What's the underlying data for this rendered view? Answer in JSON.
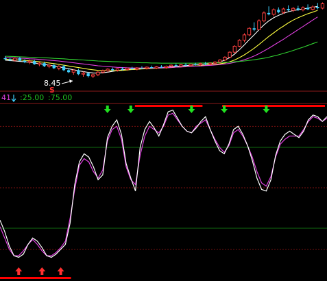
{
  "colors": {
    "background": "#000000",
    "divider": "#8b1a1a",
    "grid_red": "#7a1010",
    "grid_green": "#0f6b0f",
    "up_candle": "#ff4040",
    "down_candle": "#40d0ff",
    "ma_white": "#ffffff",
    "ma_yellow": "#ffff40",
    "ma_magenta": "#e040e0",
    "ma_green": "#30d030",
    "osc_white": "#ffffff",
    "osc_magenta": "#e040e0",
    "buy_arrow": "#ff3030",
    "sell_arrow": "#20e020",
    "bar_red": "#ff0000"
  },
  "price_panel": {
    "low_marker": "8.45",
    "signal_letter": "S"
  },
  "indicator_panel": {
    "value_text": "41",
    "level_low_text": ":25.00",
    "level_high_text": ":75.00"
  },
  "chart_data": [
    {
      "type": "candlestick",
      "annotation_low": "8.45",
      "ylim": [
        7.9,
        12.3
      ],
      "candles": [
        {
          "o": 9.45,
          "h": 9.55,
          "l": 9.35,
          "c": 9.4
        },
        {
          "o": 9.4,
          "h": 9.48,
          "l": 9.3,
          "c": 9.35
        },
        {
          "o": 9.35,
          "h": 9.5,
          "l": 9.28,
          "c": 9.45
        },
        {
          "o": 9.45,
          "h": 9.52,
          "l": 9.3,
          "c": 9.32
        },
        {
          "o": 9.32,
          "h": 9.4,
          "l": 9.2,
          "c": 9.25
        },
        {
          "o": 9.25,
          "h": 9.38,
          "l": 9.15,
          "c": 9.3
        },
        {
          "o": 9.3,
          "h": 9.36,
          "l": 9.12,
          "c": 9.15
        },
        {
          "o": 9.15,
          "h": 9.25,
          "l": 9.05,
          "c": 9.2
        },
        {
          "o": 9.2,
          "h": 9.28,
          "l": 9.0,
          "c": 9.05
        },
        {
          "o": 9.05,
          "h": 9.15,
          "l": 8.95,
          "c": 9.1
        },
        {
          "o": 9.1,
          "h": 9.18,
          "l": 8.9,
          "c": 8.95
        },
        {
          "o": 8.95,
          "h": 9.1,
          "l": 8.85,
          "c": 9.05
        },
        {
          "o": 9.05,
          "h": 9.12,
          "l": 8.8,
          "c": 8.85
        },
        {
          "o": 8.85,
          "h": 8.95,
          "l": 8.7,
          "c": 8.75
        },
        {
          "o": 8.75,
          "h": 8.9,
          "l": 8.62,
          "c": 8.85
        },
        {
          "o": 8.85,
          "h": 8.92,
          "l": 8.6,
          "c": 8.65
        },
        {
          "o": 8.65,
          "h": 8.78,
          "l": 8.52,
          "c": 8.7
        },
        {
          "o": 8.7,
          "h": 8.75,
          "l": 8.48,
          "c": 8.55
        },
        {
          "o": 8.55,
          "h": 8.68,
          "l": 8.45,
          "c": 8.62
        },
        {
          "o": 8.62,
          "h": 8.8,
          "l": 8.55,
          "c": 8.75
        },
        {
          "o": 8.75,
          "h": 8.88,
          "l": 8.68,
          "c": 8.82
        },
        {
          "o": 8.82,
          "h": 8.95,
          "l": 8.75,
          "c": 8.9
        },
        {
          "o": 8.9,
          "h": 8.98,
          "l": 8.8,
          "c": 8.85
        },
        {
          "o": 8.85,
          "h": 8.95,
          "l": 8.78,
          "c": 8.92
        },
        {
          "o": 8.92,
          "h": 9.0,
          "l": 8.84,
          "c": 8.88
        },
        {
          "o": 8.88,
          "h": 8.98,
          "l": 8.82,
          "c": 8.95
        },
        {
          "o": 8.95,
          "h": 9.02,
          "l": 8.86,
          "c": 8.9
        },
        {
          "o": 8.9,
          "h": 9.0,
          "l": 8.84,
          "c": 8.96
        },
        {
          "o": 8.96,
          "h": 9.05,
          "l": 8.9,
          "c": 8.94
        },
        {
          "o": 8.94,
          "h": 9.04,
          "l": 8.88,
          "c": 9.0
        },
        {
          "o": 9.0,
          "h": 9.08,
          "l": 8.92,
          "c": 8.96
        },
        {
          "o": 8.96,
          "h": 9.06,
          "l": 8.9,
          "c": 9.02
        },
        {
          "o": 9.02,
          "h": 9.1,
          "l": 8.95,
          "c": 8.98
        },
        {
          "o": 8.98,
          "h": 9.08,
          "l": 8.92,
          "c": 9.05
        },
        {
          "o": 9.05,
          "h": 9.14,
          "l": 9.0,
          "c": 9.1
        },
        {
          "o": 9.1,
          "h": 9.18,
          "l": 9.02,
          "c": 9.06
        },
        {
          "o": 9.06,
          "h": 9.16,
          "l": 9.0,
          "c": 9.12
        },
        {
          "o": 9.12,
          "h": 9.2,
          "l": 9.05,
          "c": 9.08
        },
        {
          "o": 9.08,
          "h": 9.18,
          "l": 9.02,
          "c": 9.15
        },
        {
          "o": 9.15,
          "h": 9.22,
          "l": 9.08,
          "c": 9.12
        },
        {
          "o": 9.12,
          "h": 9.22,
          "l": 9.06,
          "c": 9.18
        },
        {
          "o": 9.18,
          "h": 9.26,
          "l": 9.1,
          "c": 9.14
        },
        {
          "o": 9.14,
          "h": 9.24,
          "l": 9.08,
          "c": 9.2
        },
        {
          "o": 9.2,
          "h": 9.3,
          "l": 9.14,
          "c": 9.26
        },
        {
          "o": 9.26,
          "h": 9.4,
          "l": 9.2,
          "c": 9.36
        },
        {
          "o": 9.36,
          "h": 9.55,
          "l": 9.3,
          "c": 9.5
        },
        {
          "o": 9.5,
          "h": 9.8,
          "l": 9.45,
          "c": 9.75
        },
        {
          "o": 9.75,
          "h": 10.1,
          "l": 9.7,
          "c": 10.05
        },
        {
          "o": 10.05,
          "h": 10.4,
          "l": 10.0,
          "c": 10.35
        },
        {
          "o": 10.35,
          "h": 10.7,
          "l": 10.25,
          "c": 10.62
        },
        {
          "o": 10.62,
          "h": 11.0,
          "l": 10.55,
          "c": 10.95
        },
        {
          "o": 10.95,
          "h": 11.25,
          "l": 10.8,
          "c": 10.88
        },
        {
          "o": 10.88,
          "h": 11.4,
          "l": 10.85,
          "c": 11.32
        },
        {
          "o": 11.32,
          "h": 11.8,
          "l": 11.25,
          "c": 11.72
        },
        {
          "o": 11.72,
          "h": 12.05,
          "l": 11.6,
          "c": 11.65
        },
        {
          "o": 11.65,
          "h": 11.95,
          "l": 11.55,
          "c": 11.88
        },
        {
          "o": 11.88,
          "h": 12.0,
          "l": 11.7,
          "c": 11.75
        },
        {
          "o": 11.75,
          "h": 11.98,
          "l": 11.68,
          "c": 11.92
        },
        {
          "o": 11.92,
          "h": 12.1,
          "l": 11.8,
          "c": 11.85
        },
        {
          "o": 11.85,
          "h": 12.02,
          "l": 11.76,
          "c": 11.95
        },
        {
          "o": 11.95,
          "h": 12.08,
          "l": 11.82,
          "c": 11.88
        },
        {
          "o": 11.88,
          "h": 12.05,
          "l": 11.8,
          "c": 11.98
        },
        {
          "o": 11.98,
          "h": 12.15,
          "l": 11.86,
          "c": 11.9
        },
        {
          "o": 11.9,
          "h": 12.1,
          "l": 11.84,
          "c": 12.02
        },
        {
          "o": 12.02,
          "h": 12.22,
          "l": 11.9,
          "c": 11.96
        },
        {
          "o": 11.96,
          "h": 12.25,
          "l": 11.9,
          "c": 12.18
        }
      ],
      "ma_lines": [
        {
          "color": "ma_white",
          "values": [
            9.35,
            9.33,
            9.31,
            9.29,
            9.27,
            9.24,
            9.21,
            9.18,
            9.14,
            9.1,
            9.06,
            9.02,
            8.97,
            8.92,
            8.87,
            8.82,
            8.78,
            8.74,
            8.71,
            8.7,
            8.72,
            8.75,
            8.79,
            8.83,
            8.86,
            8.89,
            8.91,
            8.93,
            8.94,
            8.95,
            8.96,
            8.97,
            8.98,
            9.0,
            9.02,
            9.04,
            9.06,
            9.08,
            9.1,
            9.12,
            9.14,
            9.16,
            9.18,
            9.21,
            9.26,
            9.35,
            9.48,
            9.66,
            9.88,
            10.12,
            10.38,
            10.62,
            10.88,
            11.12,
            11.32,
            11.48,
            11.6,
            11.7,
            11.78,
            11.84,
            11.88,
            11.92,
            11.96,
            12.0,
            12.05
          ]
        },
        {
          "color": "ma_yellow",
          "values": [
            9.4,
            9.39,
            9.37,
            9.36,
            9.34,
            9.32,
            9.3,
            9.27,
            9.24,
            9.21,
            9.18,
            9.14,
            9.1,
            9.06,
            9.02,
            8.98,
            8.94,
            8.9,
            8.87,
            8.84,
            8.83,
            8.82,
            8.82,
            8.83,
            8.84,
            8.86,
            8.88,
            8.89,
            8.91,
            8.92,
            8.93,
            8.95,
            8.96,
            8.97,
            8.98,
            9.0,
            9.01,
            9.03,
            9.05,
            9.06,
            9.08,
            9.1,
            9.12,
            9.14,
            9.17,
            9.21,
            9.27,
            9.36,
            9.48,
            9.62,
            9.78,
            9.95,
            10.14,
            10.34,
            10.54,
            10.72,
            10.9,
            11.06,
            11.22,
            11.36,
            11.48,
            11.58,
            11.68,
            11.76,
            11.85
          ]
        },
        {
          "color": "ma_magenta",
          "values": [
            9.48,
            9.47,
            9.46,
            9.45,
            9.44,
            9.42,
            9.41,
            9.39,
            9.37,
            9.35,
            9.33,
            9.31,
            9.28,
            9.25,
            9.22,
            9.19,
            9.16,
            9.13,
            9.1,
            9.07,
            9.05,
            9.03,
            9.01,
            8.99,
            8.98,
            8.97,
            8.96,
            8.96,
            8.96,
            8.96,
            8.96,
            8.97,
            8.97,
            8.98,
            8.99,
            9.0,
            9.01,
            9.02,
            9.04,
            9.05,
            9.06,
            9.08,
            9.09,
            9.11,
            9.13,
            9.16,
            9.19,
            9.24,
            9.3,
            9.37,
            9.46,
            9.56,
            9.68,
            9.81,
            9.95,
            10.1,
            10.25,
            10.4,
            10.56,
            10.72,
            10.88,
            11.04,
            11.2,
            11.36,
            11.52
          ]
        },
        {
          "color": "ma_green",
          "values": [
            9.55,
            9.54,
            9.53,
            9.52,
            9.51,
            9.5,
            9.49,
            9.48,
            9.47,
            9.46,
            9.44,
            9.43,
            9.42,
            9.4,
            9.39,
            9.37,
            9.36,
            9.34,
            9.33,
            9.31,
            9.3,
            9.29,
            9.28,
            9.27,
            9.26,
            9.25,
            9.24,
            9.23,
            9.22,
            9.22,
            9.21,
            9.21,
            9.2,
            9.2,
            9.2,
            9.2,
            9.2,
            9.2,
            9.2,
            9.2,
            9.21,
            9.21,
            9.22,
            9.22,
            9.23,
            9.24,
            9.25,
            9.27,
            9.29,
            9.31,
            9.34,
            9.37,
            9.41,
            9.45,
            9.5,
            9.56,
            9.62,
            9.69,
            9.76,
            9.84,
            9.92,
            10.0,
            10.09,
            10.18,
            10.27
          ]
        }
      ]
    },
    {
      "type": "line",
      "ylim": [
        0,
        100
      ],
      "levels": [
        25,
        75
      ],
      "series": [
        {
          "name": "",
          "color": "osc_white",
          "values": [
            30,
            23,
            14,
            8,
            7,
            9,
            15,
            19,
            17,
            13,
            8,
            7,
            9,
            12,
            15,
            28,
            52,
            66,
            71,
            69,
            63,
            55,
            58,
            81,
            88,
            92,
            83,
            65,
            56,
            48,
            75,
            86,
            91,
            87,
            82,
            89,
            97,
            98,
            93,
            88,
            85,
            84,
            87,
            91,
            94,
            86,
            79,
            73,
            71,
            77,
            86,
            88,
            83,
            76,
            67,
            56,
            49,
            48,
            55,
            70,
            79,
            83,
            85,
            83,
            81,
            85,
            92,
            95,
            94,
            91,
            94
          ]
        },
        {
          "name": "",
          "color": "osc_magenta",
          "values": [
            26,
            19,
            12,
            8,
            8,
            11,
            15,
            18,
            15,
            11,
            8,
            8,
            10,
            13,
            17,
            31,
            49,
            64,
            68,
            66,
            60,
            56,
            61,
            79,
            86,
            88,
            80,
            63,
            55,
            52,
            70,
            82,
            88,
            86,
            84,
            88,
            95,
            96,
            92,
            88,
            85,
            84,
            88,
            90,
            92,
            86,
            80,
            75,
            72,
            76,
            84,
            86,
            82,
            76,
            69,
            60,
            53,
            51,
            57,
            69,
            77,
            80,
            82,
            82,
            82,
            86,
            91,
            94,
            93,
            91,
            93
          ]
        }
      ],
      "buy_arrow_indices": [
        4,
        9,
        13
      ],
      "sell_arrow_indices": [
        23,
        28,
        41,
        48,
        57
      ]
    }
  ]
}
